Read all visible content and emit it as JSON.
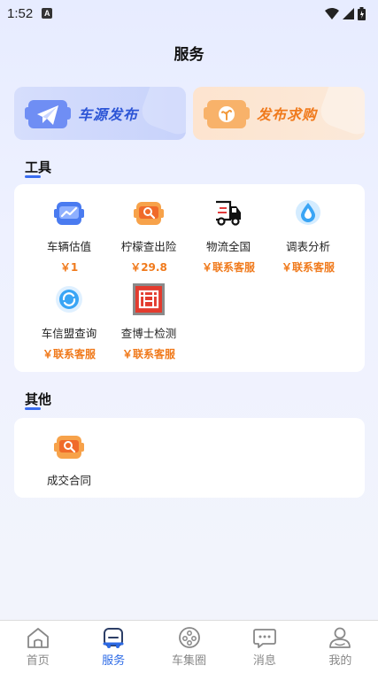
{
  "status_bar": {
    "time": "1:52",
    "notif_letter": "A"
  },
  "page": {
    "title": "服务"
  },
  "banners": [
    {
      "label": "车源发布",
      "icon": "paper-plane-icon",
      "color": "#2c55d6"
    },
    {
      "label": "发布求购",
      "icon": "sprout-icon",
      "color": "#f07a1c"
    }
  ],
  "sections": {
    "tools_title": "工具",
    "other_title": "其他"
  },
  "tools": [
    {
      "label": "车辆估值",
      "price": "￥1",
      "icon": "car-valuation-icon"
    },
    {
      "label": "柠檬查出险",
      "price": "￥29.8",
      "icon": "car-search-icon"
    },
    {
      "label": "物流全国",
      "price": "￥联系客服",
      "icon": "truck-icon"
    },
    {
      "label": "调表分析",
      "price": "￥联系客服",
      "icon": "droplet-icon"
    },
    {
      "label": "车信盟查询",
      "price": "￥联系客服",
      "icon": "refresh-circle-icon"
    },
    {
      "label": "查博士检测",
      "price": "￥联系客服",
      "icon": "chaboshi-logo-icon"
    }
  ],
  "others": [
    {
      "label": "成交合同",
      "icon": "car-search-icon"
    }
  ],
  "bottom_nav": [
    {
      "label": "首页",
      "icon": "home-icon",
      "active": false
    },
    {
      "label": "服务",
      "icon": "car-service-icon",
      "active": true
    },
    {
      "label": "车集圈",
      "icon": "circle-dots-icon",
      "active": false
    },
    {
      "label": "消息",
      "icon": "chat-bubble-icon",
      "active": false
    },
    {
      "label": "我的",
      "icon": "person-icon",
      "active": false
    }
  ],
  "colors": {
    "accent": "#2c6ae6",
    "price": "#f07a1c",
    "inactive": "#888888"
  }
}
